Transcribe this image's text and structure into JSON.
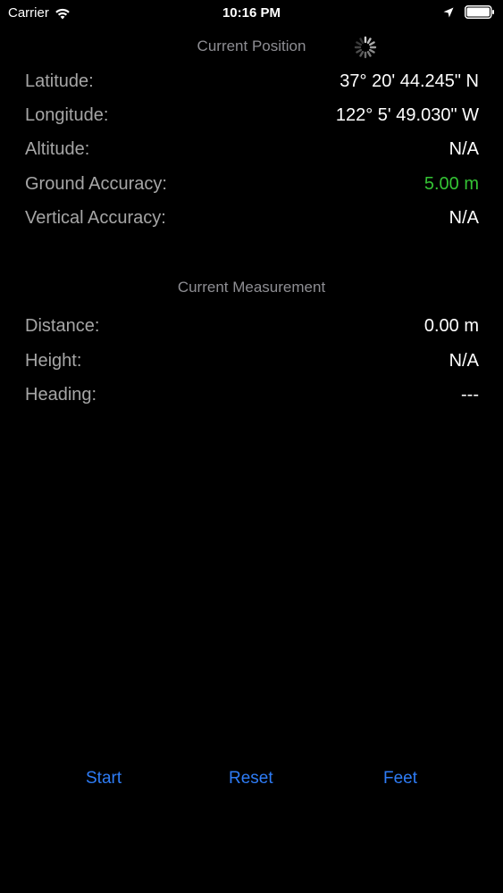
{
  "status_bar": {
    "carrier": "Carrier",
    "time": "10:16 PM"
  },
  "current_position": {
    "title": "Current Position",
    "rows": [
      {
        "label": "Latitude:",
        "value": "37° 20' 44.245\" N"
      },
      {
        "label": "Longitude:",
        "value": "122° 5' 49.030\" W"
      },
      {
        "label": "Altitude:",
        "value": "N/A"
      },
      {
        "label": "Ground Accuracy:",
        "value": "5.00 m"
      },
      {
        "label": "Vertical Accuracy:",
        "value": "N/A"
      }
    ]
  },
  "current_measurement": {
    "title": "Current Measurement",
    "rows": [
      {
        "label": "Distance:",
        "value": "0.00 m"
      },
      {
        "label": "Height:",
        "value": "N/A"
      },
      {
        "label": "Heading:",
        "value": "---"
      }
    ]
  },
  "buttons": {
    "start": "Start",
    "reset": "Reset",
    "feet": "Feet"
  },
  "colors": {
    "background": "#000000",
    "label": "#a6a6a6",
    "section_title": "#8e8e93",
    "accuracy_good": "#34c334",
    "button_tint": "#2e7cf6"
  },
  "icons": {
    "wifi": "wifi-icon",
    "location": "location-arrow-icon",
    "battery": "battery-icon",
    "spinner": "activity-spinner-icon"
  }
}
